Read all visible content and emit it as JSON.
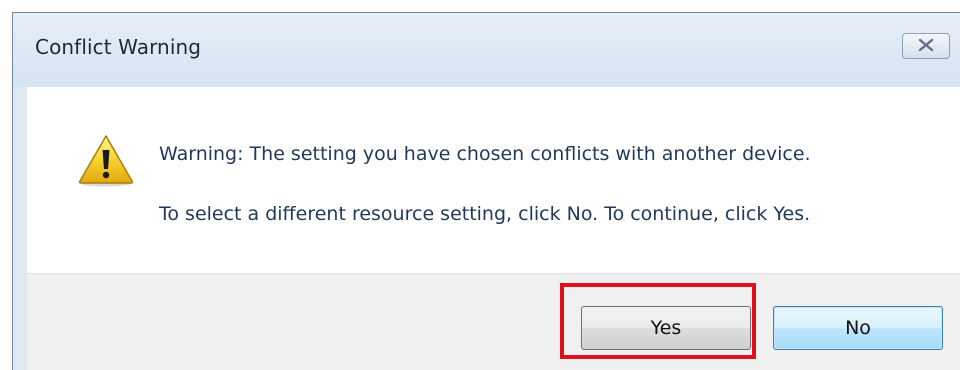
{
  "dialog": {
    "title": "Conflict Warning",
    "close_label": "⊠",
    "message_line1": "Warning: The setting you have chosen conflicts with another device.",
    "message_line2": "To select a different resource setting, click No. To continue, click Yes.",
    "icon": "warning-icon",
    "buttons": {
      "yes_label": "Yes",
      "no_label": "No"
    }
  },
  "colors": {
    "title_bar": "#dfe9f4",
    "message_text": "#1e395b",
    "highlight_box": "#e0101a",
    "default_button": "#bee6fd"
  }
}
